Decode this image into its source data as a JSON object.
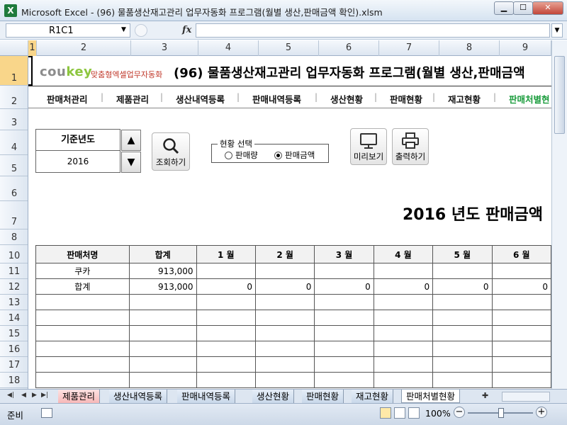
{
  "window": {
    "title": "Microsoft Excel - (96) 물품생산재고관리 업무자동화 프로그램(월별 생산,판매금액 확인).xlsm",
    "app_icon": "X",
    "minimize": "▁",
    "maximize": "☐",
    "close": "✕"
  },
  "formula_bar": {
    "name_box": "R1C1",
    "fx": "fx",
    "formula": ""
  },
  "columns": [
    "1",
    "2",
    "3",
    "4",
    "5",
    "6",
    "7",
    "8",
    "9"
  ],
  "rows": [
    "1",
    "2",
    "3",
    "4",
    "5",
    "6",
    "7",
    "8",
    "10",
    "11",
    "12",
    "13",
    "14",
    "15",
    "16",
    "17",
    "18"
  ],
  "banner": {
    "logo_cou": "cou",
    "logo_key": "key",
    "logo_sub": "맞춤형엑셀업무자동화",
    "title": "(96) 물품생산재고관리 업무자동화 프로그램(월별 생산,판매금액"
  },
  "menu": [
    "판매처관리",
    "제품관리",
    "생산내역등록",
    "판매내역등록",
    "생산현황",
    "판매현황",
    "재고현황",
    "판매처별현"
  ],
  "controls": {
    "year_label": "기준년도",
    "year_value": "2016",
    "spin_up": "▲",
    "spin_down": "▼",
    "search_label": "조회하기",
    "status_legend": "현황 선택",
    "radio_qty": "판매량",
    "radio_amt": "판매금액",
    "radio_selected": "판매금액",
    "preview_label": "미리보기",
    "print_label": "출력하기"
  },
  "report_title": "2016 년도 판매금액",
  "table": {
    "headers": [
      "판매처명",
      "합계",
      "1 월",
      "2 월",
      "3 월",
      "4 월",
      "5 월",
      "6 월"
    ],
    "rows": [
      [
        "쿠카",
        "913,000",
        "",
        "",
        "",
        "",
        "",
        ""
      ],
      [
        "합계",
        "913,000",
        "0",
        "0",
        "0",
        "0",
        "0",
        "0"
      ],
      [
        "",
        "",
        "",
        "",
        "",
        "",
        "",
        ""
      ],
      [
        "",
        "",
        "",
        "",
        "",
        "",
        "",
        ""
      ],
      [
        "",
        "",
        "",
        "",
        "",
        "",
        "",
        ""
      ],
      [
        "",
        "",
        "",
        "",
        "",
        "",
        "",
        ""
      ],
      [
        "",
        "",
        "",
        "",
        "",
        "",
        "",
        ""
      ],
      [
        "",
        "",
        "",
        "",
        "",
        "",
        "",
        ""
      ]
    ]
  },
  "sheet_tabs": [
    {
      "label": "제품관리",
      "style": "red"
    },
    {
      "label": "생산내역등록",
      "style": "blue"
    },
    {
      "label": "판매내역등록",
      "style": "blue"
    },
    {
      "label": "생산현황",
      "style": "blue"
    },
    {
      "label": "판매현황",
      "style": "blue"
    },
    {
      "label": "재고현황",
      "style": "blue"
    },
    {
      "label": "판매처별현황",
      "style": "active"
    }
  ],
  "status_bar": {
    "status": "준비",
    "zoom": "100%",
    "zoom_minus": "−",
    "zoom_plus": "+"
  }
}
